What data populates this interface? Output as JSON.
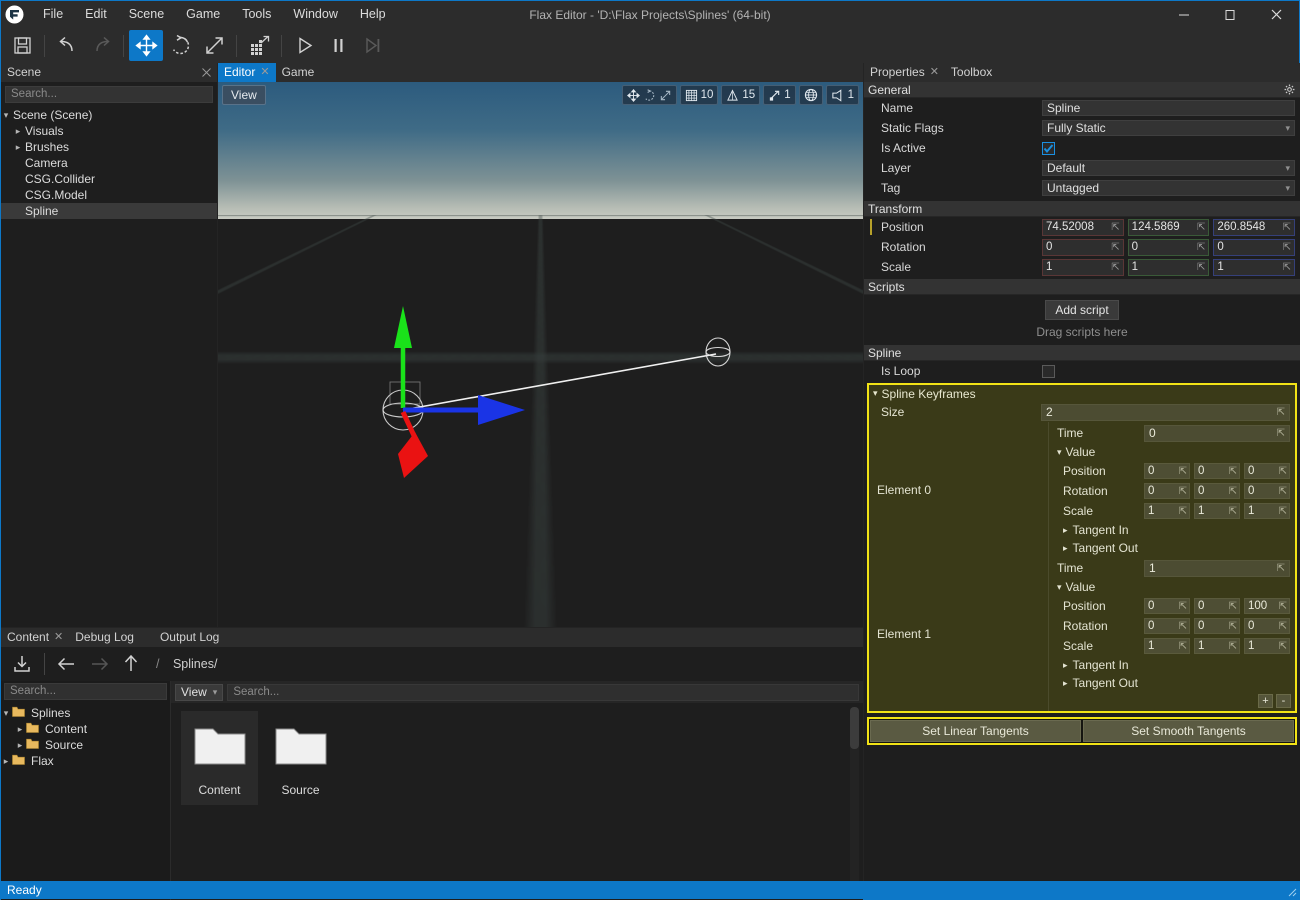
{
  "window": {
    "title": "Flax Editor - 'D:\\Flax Projects\\Splines' (64-bit)",
    "minimize": "–",
    "maximize": "❑",
    "close": "✕"
  },
  "menubar": {
    "items": [
      "File",
      "Edit",
      "Scene",
      "Game",
      "Tools",
      "Window",
      "Help"
    ]
  },
  "toolbar": {
    "buttons": [
      {
        "name": "save-button",
        "icon": "save-icon",
        "state": "normal"
      },
      {
        "name": "undo-button",
        "icon": "undo-icon",
        "state": "normal"
      },
      {
        "name": "redo-button",
        "icon": "redo-icon",
        "state": "disabled"
      },
      {
        "name": "translate-gizmo-button",
        "icon": "move-icon",
        "state": "active"
      },
      {
        "name": "rotate-gizmo-button",
        "icon": "rotate-icon",
        "state": "normal"
      },
      {
        "name": "scale-gizmo-button",
        "icon": "scale-icon",
        "state": "normal"
      },
      {
        "name": "snap-grid-button",
        "icon": "grid-snap-icon",
        "state": "normal"
      },
      {
        "name": "play-button",
        "icon": "play-icon",
        "state": "normal"
      },
      {
        "name": "pause-button",
        "icon": "pause-icon",
        "state": "normal"
      },
      {
        "name": "step-button",
        "icon": "step-icon",
        "state": "disabled"
      }
    ]
  },
  "scene_panel": {
    "tab": "Scene",
    "search_placeholder": "Search...",
    "tree": [
      {
        "label": "Scene (Scene)",
        "indent": 0,
        "arrow": "down",
        "selected": false
      },
      {
        "label": "Visuals",
        "indent": 1,
        "arrow": "right",
        "selected": false
      },
      {
        "label": "Brushes",
        "indent": 1,
        "arrow": "right",
        "selected": false
      },
      {
        "label": "Camera",
        "indent": 1,
        "arrow": "none",
        "selected": false
      },
      {
        "label": "CSG.Collider",
        "indent": 1,
        "arrow": "none",
        "selected": false
      },
      {
        "label": "CSG.Model",
        "indent": 1,
        "arrow": "none",
        "selected": false
      },
      {
        "label": "Spline",
        "indent": 1,
        "arrow": "none",
        "selected": true
      }
    ]
  },
  "viewport": {
    "tabs": [
      {
        "label": "Editor",
        "active": true,
        "closable": true
      },
      {
        "label": "Game",
        "active": false,
        "closable": false
      }
    ],
    "view_button": "View",
    "toolbar_groups": [
      {
        "name": "gizmo-mode-group",
        "icons": [
          "move-icon",
          "rotate-icon",
          "scale-icon"
        ],
        "value": ""
      },
      {
        "name": "grid-snap-group",
        "icons": [
          "grid-icon"
        ],
        "value": "10"
      },
      {
        "name": "angle-snap-group",
        "icons": [
          "angle-icon"
        ],
        "value": "15"
      },
      {
        "name": "scale-snap-group",
        "icons": [
          "scale-snap-icon"
        ],
        "value": "1"
      },
      {
        "name": "transform-space-group",
        "icons": [
          "globe-icon"
        ],
        "value": ""
      },
      {
        "name": "camera-speed-group",
        "icons": [
          "speed-icon"
        ],
        "value": "1"
      }
    ]
  },
  "properties": {
    "tabs": [
      {
        "label": "Properties",
        "active": true,
        "closable": true
      },
      {
        "label": "Toolbox",
        "active": false,
        "closable": false
      }
    ],
    "general": {
      "header": "General",
      "name_label": "Name",
      "name_value": "Spline",
      "static_flags_label": "Static Flags",
      "static_flags_value": "Fully Static",
      "is_active_label": "Is Active",
      "is_active_checked": true,
      "layer_label": "Layer",
      "layer_value": "Default",
      "tag_label": "Tag",
      "tag_value": "Untagged"
    },
    "transform": {
      "header": "Transform",
      "rows": [
        {
          "label": "Position",
          "x": "74.52008",
          "y": "124.5869",
          "z": "260.8548"
        },
        {
          "label": "Rotation",
          "x": "0",
          "y": "0",
          "z": "0"
        },
        {
          "label": "Scale",
          "x": "1",
          "y": "1",
          "z": "1"
        }
      ]
    },
    "scripts": {
      "header": "Scripts",
      "add_label": "Add script",
      "drag_hint": "Drag scripts here"
    },
    "spline": {
      "header": "Spline",
      "is_loop_label": "Is Loop",
      "is_loop_checked": false,
      "keyframes_header": "Spline Keyframes",
      "size_label": "Size",
      "size_value": "2",
      "elements": [
        {
          "name": "Element 0",
          "time_label": "Time",
          "time_value": "0",
          "value_label": "Value",
          "position_label": "Position",
          "position": [
            "0",
            "0",
            "0"
          ],
          "rotation_label": "Rotation",
          "rotation": [
            "0",
            "0",
            "0"
          ],
          "scale_label": "Scale",
          "scale": [
            "1",
            "1",
            "1"
          ],
          "tangent_in_label": "Tangent In",
          "tangent_out_label": "Tangent Out"
        },
        {
          "name": "Element 1",
          "time_label": "Time",
          "time_value": "1",
          "value_label": "Value",
          "position_label": "Position",
          "position": [
            "0",
            "0",
            "100"
          ],
          "rotation_label": "Rotation",
          "rotation": [
            "0",
            "0",
            "0"
          ],
          "scale_label": "Scale",
          "scale": [
            "1",
            "1",
            "1"
          ],
          "tangent_in_label": "Tangent In",
          "tangent_out_label": "Tangent Out"
        }
      ],
      "add_button": "+",
      "remove_button": "-",
      "set_linear_tangents": "Set Linear Tangents",
      "set_smooth_tangents": "Set Smooth Tangents"
    },
    "highlight_color": "#f2e316"
  },
  "content_browser": {
    "tabs": [
      {
        "label": "Content",
        "active": true,
        "closable": true
      },
      {
        "label": "Debug Log",
        "active": false,
        "closable": false
      },
      {
        "label": "Output Log",
        "active": false,
        "closable": false
      }
    ],
    "breadcrumb_sep": "/",
    "breadcrumb": "Splines/",
    "search_placeholder": "Search...",
    "tree": [
      {
        "label": "Splines",
        "indent": 0,
        "arrow": "down"
      },
      {
        "label": "Content",
        "indent": 1,
        "arrow": "right"
      },
      {
        "label": "Source",
        "indent": 1,
        "arrow": "right"
      },
      {
        "label": "Flax",
        "indent": 0,
        "arrow": "right"
      }
    ],
    "view_dropdown": "View",
    "items_search_placeholder": "Search...",
    "items": [
      {
        "name": "Content",
        "icon": "folder-icon",
        "selected": true
      },
      {
        "name": "Source",
        "icon": "folder-icon",
        "selected": false
      }
    ]
  },
  "status_bar": {
    "text": "Ready"
  }
}
